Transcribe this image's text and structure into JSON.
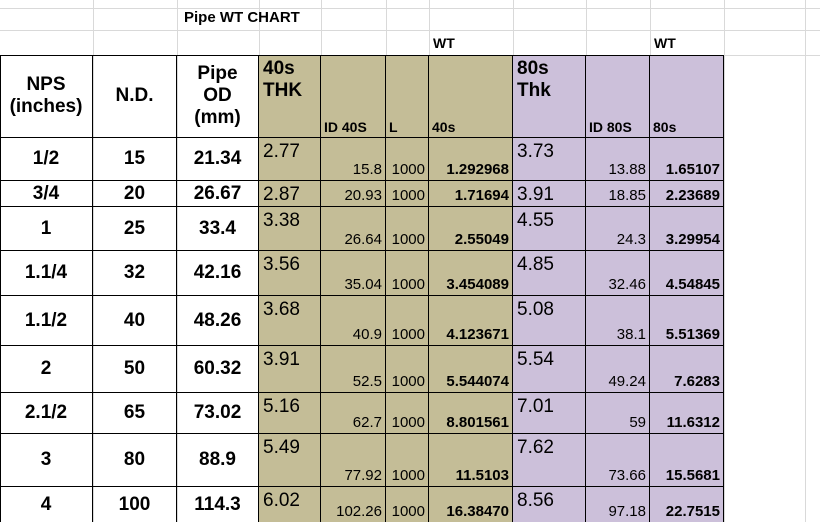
{
  "title": "Pipe  WT CHART",
  "wt_label_40s": "WT",
  "wt_label_80s": "WT",
  "headers": {
    "nps": "NPS\n(inches)",
    "nd": "N.D.",
    "od": "Pipe\nOD\n(mm)",
    "thk40": "40s\nTHK",
    "id40": "ID 40S",
    "l": "L",
    "wt40": "40s",
    "thk80": "80s\nThk",
    "id80": "ID 80S",
    "wt80": "80s"
  },
  "colors": {
    "tan": "#c4bd97",
    "lavender": "#ccc0da",
    "gridline": "#d9d9d9",
    "border": "#000000"
  },
  "rows": [
    {
      "nps": "1/2",
      "nd": "15",
      "od": "21.34",
      "thk40": "2.77",
      "id40": "15.8",
      "l": "1000",
      "wt40": "1.292968",
      "thk80": "3.73",
      "id80": "13.88",
      "wt80": "1.65107"
    },
    {
      "nps": "3/4",
      "nd": "20",
      "od": "26.67",
      "thk40": "2.87",
      "id40": "20.93",
      "l": "1000",
      "wt40": "1.71694",
      "thk80": "3.91",
      "id80": "18.85",
      "wt80": "2.23689"
    },
    {
      "nps": "1",
      "nd": "25",
      "od": "33.4",
      "thk40": "3.38",
      "id40": "26.64",
      "l": "1000",
      "wt40": "2.55049",
      "thk80": "4.55",
      "id80": "24.3",
      "wt80": "3.29954"
    },
    {
      "nps": "1.1/4",
      "nd": "32",
      "od": "42.16",
      "thk40": "3.56",
      "id40": "35.04",
      "l": "1000",
      "wt40": "3.454089",
      "thk80": "4.85",
      "id80": "32.46",
      "wt80": "4.54845"
    },
    {
      "nps": "1.1/2",
      "nd": "40",
      "od": "48.26",
      "thk40": "3.68",
      "id40": "40.9",
      "l": "1000",
      "wt40": "4.123671",
      "thk80": "5.08",
      "id80": "38.1",
      "wt80": "5.51369"
    },
    {
      "nps": "2",
      "nd": "50",
      "od": "60.32",
      "thk40": "3.91",
      "id40": "52.5",
      "l": "1000",
      "wt40": "5.544074",
      "thk80": "5.54",
      "id80": "49.24",
      "wt80": "7.6283"
    },
    {
      "nps": "2.1/2",
      "nd": "65",
      "od": "73.02",
      "thk40": "5.16",
      "id40": "62.7",
      "l": "1000",
      "wt40": "8.801561",
      "thk80": "7.01",
      "id80": "59",
      "wt80": "11.6312"
    },
    {
      "nps": "3",
      "nd": "80",
      "od": "88.9",
      "thk40": "5.49",
      "id40": "77.92",
      "l": "1000",
      "wt40": "11.5103",
      "thk80": "7.62",
      "id80": "73.66",
      "wt80": "15.5681"
    },
    {
      "nps": "4",
      "nd": "100",
      "od": "114.3",
      "thk40": "6.02",
      "id40": "102.26",
      "l": "1000",
      "wt40": "16.38470",
      "thk80": "8.56",
      "id80": "97.18",
      "wt80": "22.7515"
    }
  ]
}
